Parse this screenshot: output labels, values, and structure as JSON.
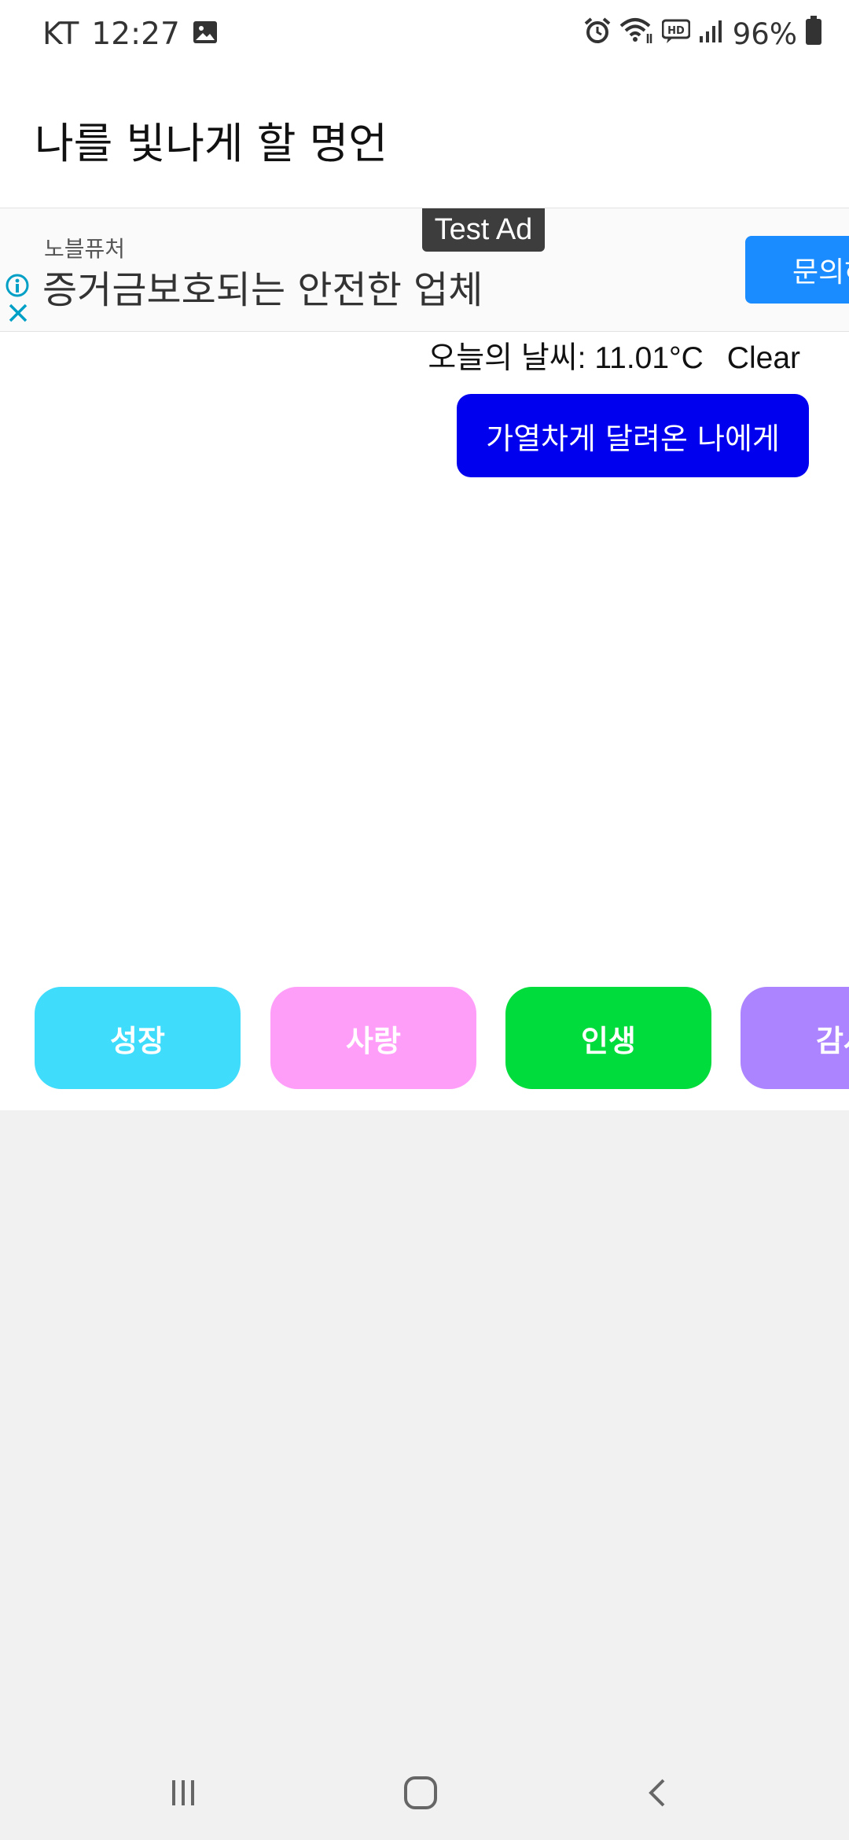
{
  "status_bar": {
    "carrier": "KT",
    "time": "12:27",
    "battery": "96%",
    "icons": [
      "gallery-icon",
      "alarm-icon",
      "wifi-icon",
      "hd-voice-icon",
      "signal-icon",
      "battery-icon"
    ]
  },
  "app": {
    "title": "나를 빛나게 할 명언"
  },
  "ad": {
    "badge": "Test Ad",
    "advertiser": "노블퓨처",
    "headline": "증거금보호되는 안전한 업체",
    "cta": "문의하기",
    "icons": [
      "info-icon",
      "close-icon"
    ],
    "cta_color": "#1a8cff"
  },
  "weather": {
    "label": "오늘의 날씨: 11.01°C",
    "condition": "Clear"
  },
  "quote_button": {
    "label": "가열차게 달려온 나에게",
    "color": "#0000ee"
  },
  "categories": [
    {
      "label": "성장",
      "color": "#40dcfb"
    },
    {
      "label": "사랑",
      "color": "#ff9ef9"
    },
    {
      "label": "인생",
      "color": "#00dc3b"
    },
    {
      "label": "감사",
      "color": "#ad84ff"
    }
  ],
  "nav": {
    "icons": [
      "recent-apps-icon",
      "home-icon",
      "back-icon"
    ]
  }
}
